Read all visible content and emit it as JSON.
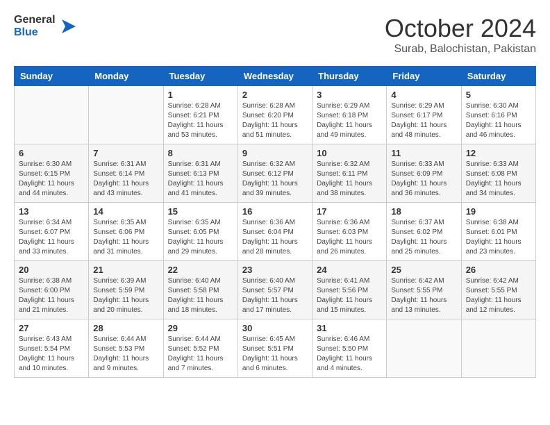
{
  "header": {
    "logo_line1": "General",
    "logo_line2": "Blue",
    "month_title": "October 2024",
    "subtitle": "Surab, Balochistan, Pakistan"
  },
  "weekdays": [
    "Sunday",
    "Monday",
    "Tuesday",
    "Wednesday",
    "Thursday",
    "Friday",
    "Saturday"
  ],
  "weeks": [
    [
      {
        "day": "",
        "sunrise": "",
        "sunset": "",
        "daylight": ""
      },
      {
        "day": "",
        "sunrise": "",
        "sunset": "",
        "daylight": ""
      },
      {
        "day": "1",
        "sunrise": "Sunrise: 6:28 AM",
        "sunset": "Sunset: 6:21 PM",
        "daylight": "Daylight: 11 hours and 53 minutes."
      },
      {
        "day": "2",
        "sunrise": "Sunrise: 6:28 AM",
        "sunset": "Sunset: 6:20 PM",
        "daylight": "Daylight: 11 hours and 51 minutes."
      },
      {
        "day": "3",
        "sunrise": "Sunrise: 6:29 AM",
        "sunset": "Sunset: 6:18 PM",
        "daylight": "Daylight: 11 hours and 49 minutes."
      },
      {
        "day": "4",
        "sunrise": "Sunrise: 6:29 AM",
        "sunset": "Sunset: 6:17 PM",
        "daylight": "Daylight: 11 hours and 48 minutes."
      },
      {
        "day": "5",
        "sunrise": "Sunrise: 6:30 AM",
        "sunset": "Sunset: 6:16 PM",
        "daylight": "Daylight: 11 hours and 46 minutes."
      }
    ],
    [
      {
        "day": "6",
        "sunrise": "Sunrise: 6:30 AM",
        "sunset": "Sunset: 6:15 PM",
        "daylight": "Daylight: 11 hours and 44 minutes."
      },
      {
        "day": "7",
        "sunrise": "Sunrise: 6:31 AM",
        "sunset": "Sunset: 6:14 PM",
        "daylight": "Daylight: 11 hours and 43 minutes."
      },
      {
        "day": "8",
        "sunrise": "Sunrise: 6:31 AM",
        "sunset": "Sunset: 6:13 PM",
        "daylight": "Daylight: 11 hours and 41 minutes."
      },
      {
        "day": "9",
        "sunrise": "Sunrise: 6:32 AM",
        "sunset": "Sunset: 6:12 PM",
        "daylight": "Daylight: 11 hours and 39 minutes."
      },
      {
        "day": "10",
        "sunrise": "Sunrise: 6:32 AM",
        "sunset": "Sunset: 6:11 PM",
        "daylight": "Daylight: 11 hours and 38 minutes."
      },
      {
        "day": "11",
        "sunrise": "Sunrise: 6:33 AM",
        "sunset": "Sunset: 6:09 PM",
        "daylight": "Daylight: 11 hours and 36 minutes."
      },
      {
        "day": "12",
        "sunrise": "Sunrise: 6:33 AM",
        "sunset": "Sunset: 6:08 PM",
        "daylight": "Daylight: 11 hours and 34 minutes."
      }
    ],
    [
      {
        "day": "13",
        "sunrise": "Sunrise: 6:34 AM",
        "sunset": "Sunset: 6:07 PM",
        "daylight": "Daylight: 11 hours and 33 minutes."
      },
      {
        "day": "14",
        "sunrise": "Sunrise: 6:35 AM",
        "sunset": "Sunset: 6:06 PM",
        "daylight": "Daylight: 11 hours and 31 minutes."
      },
      {
        "day": "15",
        "sunrise": "Sunrise: 6:35 AM",
        "sunset": "Sunset: 6:05 PM",
        "daylight": "Daylight: 11 hours and 29 minutes."
      },
      {
        "day": "16",
        "sunrise": "Sunrise: 6:36 AM",
        "sunset": "Sunset: 6:04 PM",
        "daylight": "Daylight: 11 hours and 28 minutes."
      },
      {
        "day": "17",
        "sunrise": "Sunrise: 6:36 AM",
        "sunset": "Sunset: 6:03 PM",
        "daylight": "Daylight: 11 hours and 26 minutes."
      },
      {
        "day": "18",
        "sunrise": "Sunrise: 6:37 AM",
        "sunset": "Sunset: 6:02 PM",
        "daylight": "Daylight: 11 hours and 25 minutes."
      },
      {
        "day": "19",
        "sunrise": "Sunrise: 6:38 AM",
        "sunset": "Sunset: 6:01 PM",
        "daylight": "Daylight: 11 hours and 23 minutes."
      }
    ],
    [
      {
        "day": "20",
        "sunrise": "Sunrise: 6:38 AM",
        "sunset": "Sunset: 6:00 PM",
        "daylight": "Daylight: 11 hours and 21 minutes."
      },
      {
        "day": "21",
        "sunrise": "Sunrise: 6:39 AM",
        "sunset": "Sunset: 5:59 PM",
        "daylight": "Daylight: 11 hours and 20 minutes."
      },
      {
        "day": "22",
        "sunrise": "Sunrise: 6:40 AM",
        "sunset": "Sunset: 5:58 PM",
        "daylight": "Daylight: 11 hours and 18 minutes."
      },
      {
        "day": "23",
        "sunrise": "Sunrise: 6:40 AM",
        "sunset": "Sunset: 5:57 PM",
        "daylight": "Daylight: 11 hours and 17 minutes."
      },
      {
        "day": "24",
        "sunrise": "Sunrise: 6:41 AM",
        "sunset": "Sunset: 5:56 PM",
        "daylight": "Daylight: 11 hours and 15 minutes."
      },
      {
        "day": "25",
        "sunrise": "Sunrise: 6:42 AM",
        "sunset": "Sunset: 5:55 PM",
        "daylight": "Daylight: 11 hours and 13 minutes."
      },
      {
        "day": "26",
        "sunrise": "Sunrise: 6:42 AM",
        "sunset": "Sunset: 5:55 PM",
        "daylight": "Daylight: 11 hours and 12 minutes."
      }
    ],
    [
      {
        "day": "27",
        "sunrise": "Sunrise: 6:43 AM",
        "sunset": "Sunset: 5:54 PM",
        "daylight": "Daylight: 11 hours and 10 minutes."
      },
      {
        "day": "28",
        "sunrise": "Sunrise: 6:44 AM",
        "sunset": "Sunset: 5:53 PM",
        "daylight": "Daylight: 11 hours and 9 minutes."
      },
      {
        "day": "29",
        "sunrise": "Sunrise: 6:44 AM",
        "sunset": "Sunset: 5:52 PM",
        "daylight": "Daylight: 11 hours and 7 minutes."
      },
      {
        "day": "30",
        "sunrise": "Sunrise: 6:45 AM",
        "sunset": "Sunset: 5:51 PM",
        "daylight": "Daylight: 11 hours and 6 minutes."
      },
      {
        "day": "31",
        "sunrise": "Sunrise: 6:46 AM",
        "sunset": "Sunset: 5:50 PM",
        "daylight": "Daylight: 11 hours and 4 minutes."
      },
      {
        "day": "",
        "sunrise": "",
        "sunset": "",
        "daylight": ""
      },
      {
        "day": "",
        "sunrise": "",
        "sunset": "",
        "daylight": ""
      }
    ]
  ]
}
